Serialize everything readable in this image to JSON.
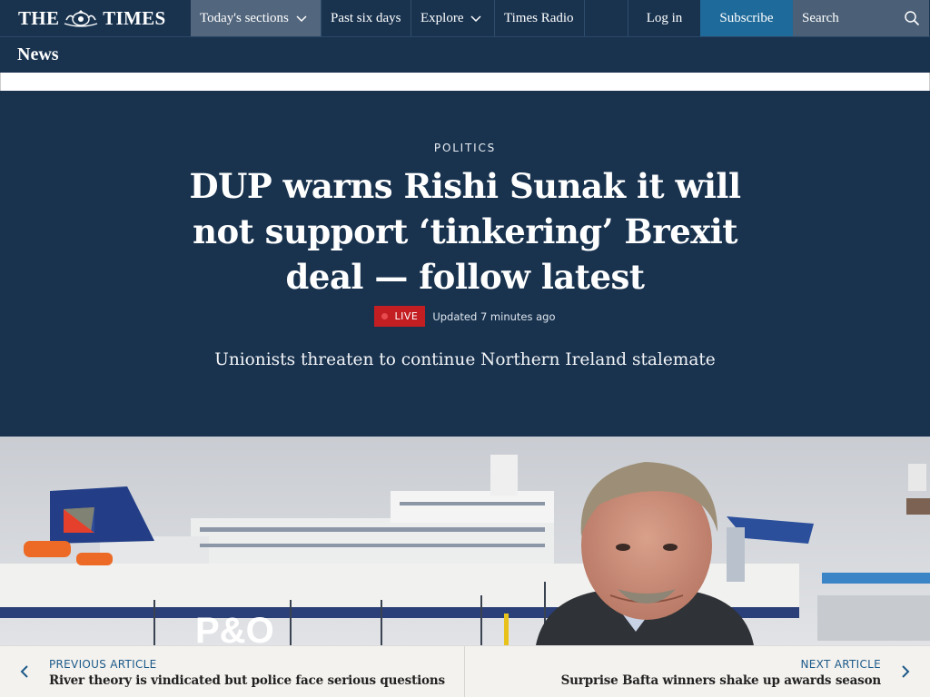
{
  "brand": {
    "name_left": "THE",
    "name_right": "TIMES"
  },
  "nav": {
    "items": [
      "Today's sections",
      "Past six days",
      "Explore",
      "Times Radio"
    ],
    "login": "Log in",
    "subscribe": "Subscribe",
    "search_placeholder": "Search"
  },
  "section_title": "News",
  "article": {
    "kicker": "POLITICS",
    "headline": "DUP warns Rishi Sunak it will not support ‘tinkering’ Brexit deal — follow latest",
    "live_label": "LIVE",
    "updated": "Updated 7 minutes ago",
    "standfirst": "Unionists threaten to continue Northern Ireland stalemate"
  },
  "photo": {
    "ship_lettering": "P&O"
  },
  "article_nav": {
    "previous": {
      "label": "PREVIOUS ARTICLE",
      "title": "River theory is vindicated but police face serious questions"
    },
    "next": {
      "label": "NEXT ARTICLE",
      "title": "Surprise Bafta winners shake up awards season"
    }
  },
  "colors": {
    "navy": "#19334f",
    "subscribe_blue": "#1e6a9a",
    "live_red": "#c31e22",
    "link_blue": "#1d5a8a"
  }
}
